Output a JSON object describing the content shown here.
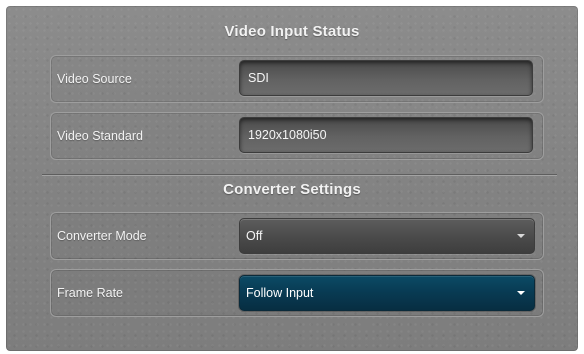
{
  "sections": {
    "video_input_status": {
      "title": "Video Input Status",
      "video_source": {
        "label": "Video Source",
        "value": "SDI"
      },
      "video_standard": {
        "label": "Video Standard",
        "value": "1920x1080i50"
      }
    },
    "converter_settings": {
      "title": "Converter Settings",
      "converter_mode": {
        "label": "Converter Mode",
        "selected": "Off"
      },
      "frame_rate": {
        "label": "Frame Rate",
        "selected": "Follow Input"
      }
    }
  },
  "colors": {
    "panel_bg": "#858585",
    "field_bg": "#555555",
    "active_select_bg": "#083a52",
    "text": "#f5f5f5"
  },
  "icons": {
    "dropdown": "chevron-down-icon"
  }
}
